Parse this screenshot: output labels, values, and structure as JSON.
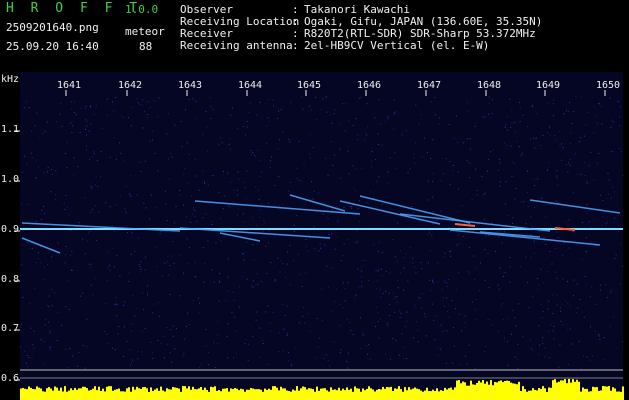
{
  "header": {
    "app_title": "H R O F F T",
    "app_version": "1.0.0",
    "file_name": "2509201640.png",
    "event_type": "meteor",
    "timestamp": "25.09.20 16:40",
    "event_count": "88"
  },
  "station": [
    {
      "label": "Observer",
      "value": "Takanori Kawachi"
    },
    {
      "label": "Receiving Location",
      "value": "Ogaki, Gifu, JAPAN (136.60E, 35.35N)"
    },
    {
      "label": "Receiver",
      "value": "R820T2(RTL-SDR) SDR-Sharp 53.372MHz"
    },
    {
      "label": "Receiving antenna",
      "value": "2el-HB9CV Vertical (el. E-W)"
    }
  ],
  "colon": ":",
  "spectrogram": {
    "y_unit": "kHz",
    "y_ticks": [
      "1.1",
      "1.0",
      "0.9",
      "0.8",
      "0.7",
      "0.6"
    ],
    "x_ticks": [
      "1641",
      "1642",
      "1643",
      "1644",
      "1645",
      "1646",
      "1647",
      "1648",
      "1649",
      "1650"
    ],
    "colors": {
      "background": "#050524",
      "carrier": "#7fdcff",
      "trail": "#4fa8ff",
      "strong": "#ff6040",
      "amplitude": "#ffff00"
    }
  }
}
